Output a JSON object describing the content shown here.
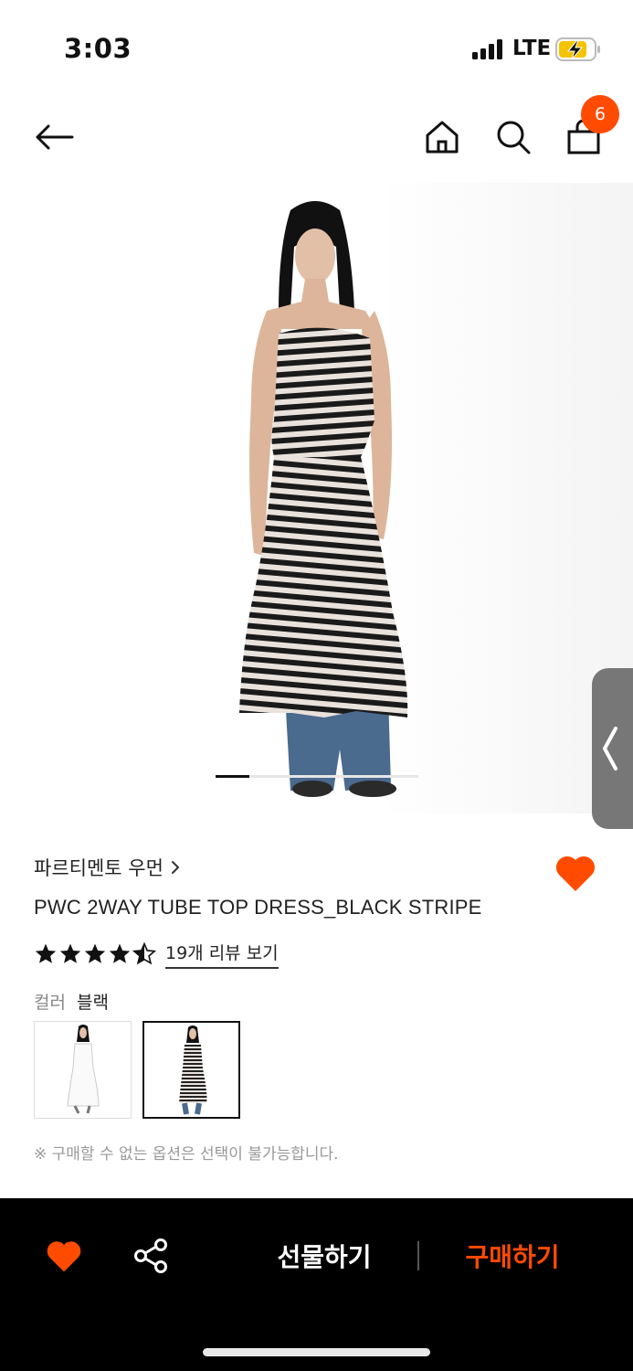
{
  "status_bar": {
    "time": "3:03",
    "network": "LTE",
    "battery_color": "#f5c400"
  },
  "nav": {
    "back_icon": "back-arrow-icon",
    "home_icon": "home-icon",
    "search_icon": "search-icon",
    "cart_icon": "shopping-bag-icon",
    "cart_count": "6"
  },
  "product": {
    "brand": "파르티멘토 우먼",
    "title": "PWC 2WAY TUBE TOP DRESS_BLACK STRIPE",
    "rating": 4.5,
    "rating_max": 5,
    "review_link": "19개 리뷰 보기",
    "color_label": "컬러",
    "color_value": "블랙",
    "swatches": [
      "white-dress",
      "black-stripe-dress"
    ],
    "selected_swatch": 1,
    "notice": "※ 구매할 수 없는 옵션은 선택이 불가능합니다.",
    "image_index": 1,
    "image_count": 6
  },
  "bottom_bar": {
    "gift_label": "선물하기",
    "buy_label": "구매하기"
  },
  "colors": {
    "accent": "#ff4b00",
    "bottom_bar_bg": "#000000"
  }
}
